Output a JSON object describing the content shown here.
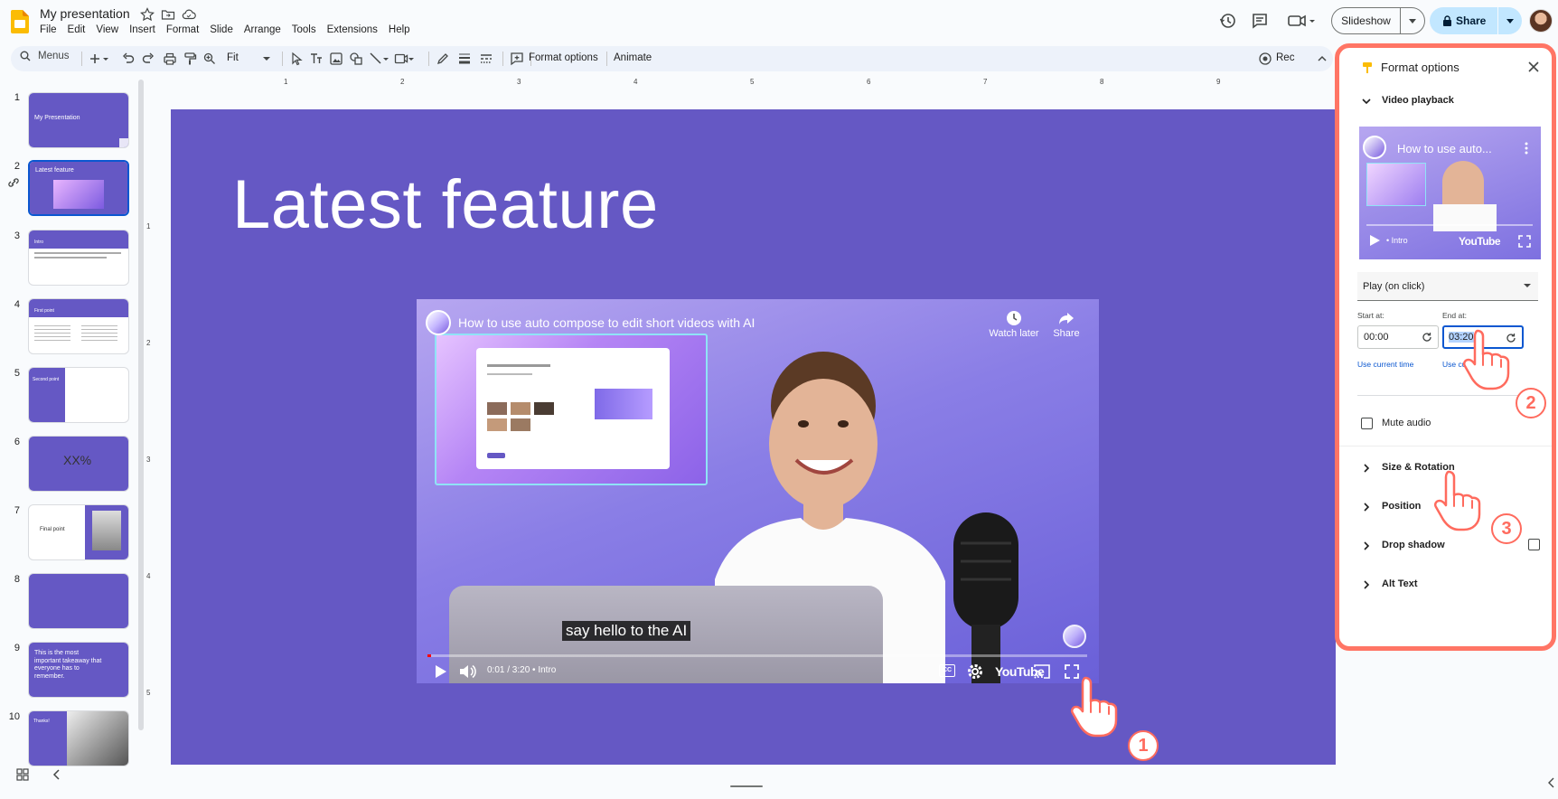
{
  "app": {
    "title": "My presentation",
    "menus": [
      "File",
      "Edit",
      "View",
      "Insert",
      "Format",
      "Slide",
      "Arrange",
      "Tools",
      "Extensions",
      "Help"
    ],
    "slideshow_label": "Slideshow",
    "share_label": "Share"
  },
  "toolbar": {
    "menus_label": "Menus",
    "zoom_value": "Fit",
    "format_options_label": "Format options",
    "animate_label": "Animate",
    "rec_label": "Rec"
  },
  "filmstrip": {
    "slides": [
      {
        "number": "1",
        "title": "My Presentation"
      },
      {
        "number": "2",
        "title": "Latest feature"
      },
      {
        "number": "3",
        "title": "Intro"
      },
      {
        "number": "4",
        "title": "First point"
      },
      {
        "number": "5",
        "title": "Second point"
      },
      {
        "number": "6",
        "title": "XX%"
      },
      {
        "number": "7",
        "title": "Final point"
      },
      {
        "number": "8",
        "title": ""
      },
      {
        "number": "9",
        "title": "This is the most important takeaway that everyone has to remember."
      },
      {
        "number": "10",
        "title": "Thanks!"
      }
    ],
    "selected_index": 1
  },
  "ruler": {
    "horizontal": [
      "1",
      "2",
      "3",
      "4",
      "5",
      "6",
      "7",
      "8",
      "9"
    ],
    "vertical": [
      "1",
      "2",
      "3",
      "4",
      "5"
    ]
  },
  "slide": {
    "title": "Latest feature",
    "video": {
      "title": "How to use auto compose to edit short videos with AI",
      "watch_later": "Watch later",
      "share": "Share",
      "caption": "say hello to the AI",
      "time": "0:01 / 3:20",
      "chapter": "• Intro",
      "progress_fraction": 0.005,
      "brand": "YouTube",
      "cc": "CC"
    }
  },
  "panel": {
    "title": "Format options",
    "sections": {
      "video_playback": "Video playback",
      "size_rotation": "Size & Rotation",
      "position": "Position",
      "drop_shadow": "Drop shadow",
      "alt_text": "Alt Text"
    },
    "preview_title": "How to use auto...",
    "preview_chapter": "• Intro",
    "preview_brand": "YouTube",
    "play_mode": "Play (on click)",
    "start_label": "Start at:",
    "start_value": "00:00",
    "end_label": "End at:",
    "end_value": "03:20",
    "use_current_time": "Use current time",
    "use_current_time_truncated": "Use curre",
    "mute_audio": "Mute audio",
    "mute_checked": false,
    "drop_shadow_checked": false
  },
  "annotations": {
    "badges": [
      "1",
      "2",
      "3"
    ],
    "accent_color": "#ff7565"
  },
  "colors": {
    "slide_bg": "#6558c4",
    "share_bg": "#c2e7ff",
    "accent_blue": "#0b57d0"
  }
}
